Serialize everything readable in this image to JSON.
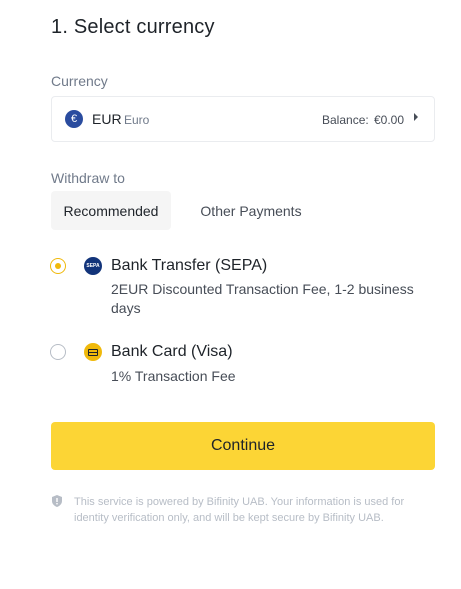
{
  "header": {
    "title": "1. Select currency"
  },
  "currency": {
    "label": "Currency",
    "symbol": "€",
    "code": "EUR",
    "name": "Euro",
    "balance_label": "Balance:",
    "balance_value": "€0.00"
  },
  "withdraw": {
    "label": "Withdraw to",
    "tabs": [
      {
        "label": "Recommended",
        "active": true
      },
      {
        "label": "Other Payments",
        "active": false
      }
    ],
    "methods": [
      {
        "title": "Bank Transfer (SEPA)",
        "description": "2EUR Discounted Transaction Fee, 1-2 business days",
        "selected": true,
        "icon": "sepa-icon",
        "icon_text": "SEPA"
      },
      {
        "title": "Bank Card (Visa)",
        "description": "1% Transaction Fee",
        "selected": false,
        "icon": "card-icon"
      }
    ]
  },
  "actions": {
    "continue_label": "Continue"
  },
  "footer": {
    "disclaimer": "This service is powered by Bifinity UAB. Your information is used for identity verification only, and will be kept secure by Bifinity UAB."
  },
  "colors": {
    "accent": "#fcd535",
    "radio_selected": "#f0b90b",
    "text_primary": "#1e2329",
    "text_secondary": "#707a8a",
    "eur_icon_bg": "#2a4c9f",
    "sepa_icon_bg": "#12347a"
  }
}
